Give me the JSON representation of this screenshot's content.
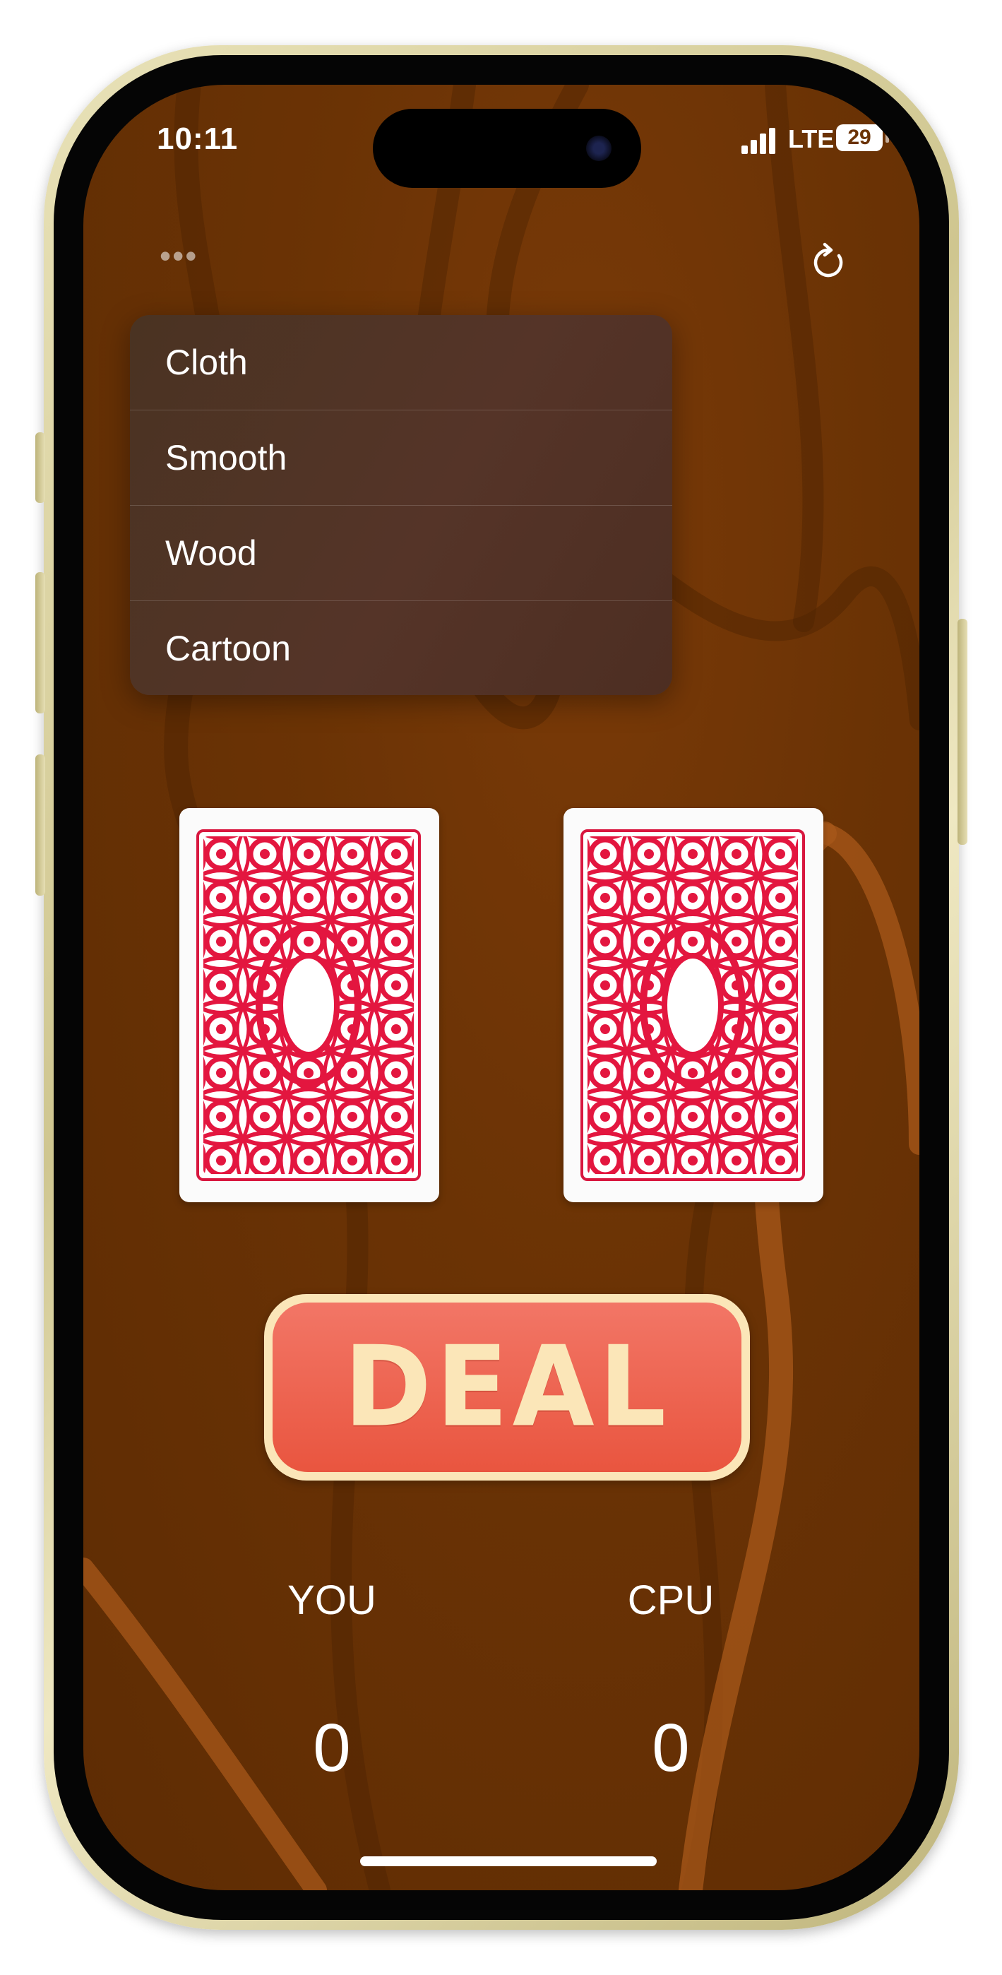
{
  "status_bar": {
    "time": "10:11",
    "network": "LTE",
    "battery": "29"
  },
  "toolbar": {
    "more_icon": "ellipsis-icon",
    "reset_icon": "refresh-icon"
  },
  "background_menu": {
    "items": [
      {
        "label": "Cloth"
      },
      {
        "label": "Smooth"
      },
      {
        "label": "Wood"
      },
      {
        "label": "Cartoon"
      }
    ]
  },
  "cards": {
    "player_card": "card-back",
    "cpu_card": "card-back"
  },
  "deal_button": {
    "label": "DEAL"
  },
  "scores": {
    "player": {
      "label": "YOU",
      "value": "0"
    },
    "cpu": {
      "label": "CPU",
      "value": "0"
    }
  },
  "colors": {
    "table_wood": "#6b3305",
    "card_back_red": "#d8173f",
    "deal_button": "#ec5f4b",
    "deal_text": "#fbe6b8"
  }
}
